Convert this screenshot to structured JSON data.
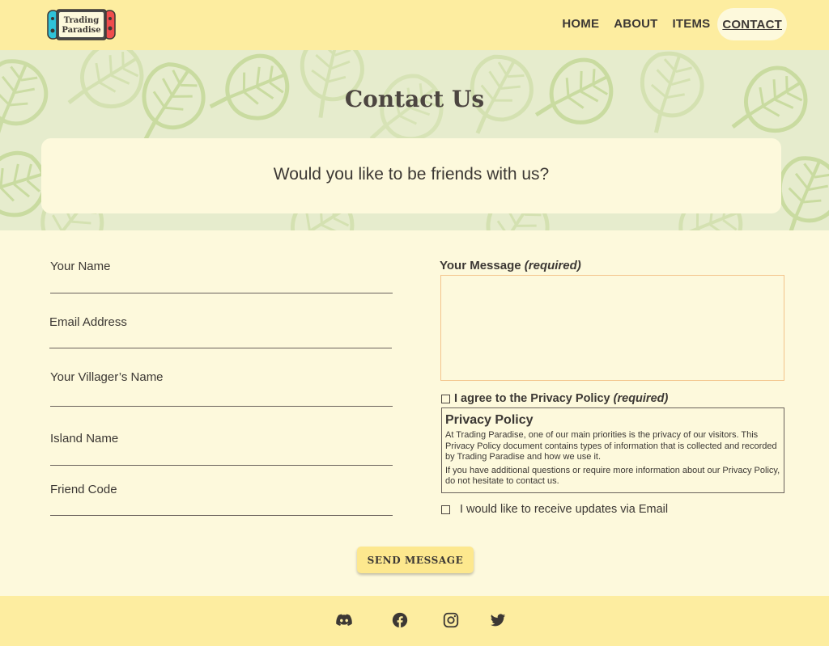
{
  "header": {
    "logo_line1": "Trading",
    "logo_line2": "Paradise",
    "nav": [
      {
        "label": "HOME"
      },
      {
        "label": "ABOUT"
      },
      {
        "label": "ITEMS"
      },
      {
        "label": "CONTACT"
      }
    ]
  },
  "hero": {
    "title": "Contact Us",
    "subtitle": "Would you like to be friends with us?"
  },
  "form": {
    "fields": [
      {
        "label": "Your Name",
        "value": ""
      },
      {
        "label": "Email Address",
        "value": ""
      },
      {
        "label": "Your Villager’s Name",
        "value": ""
      },
      {
        "label": "Island Name",
        "value": ""
      },
      {
        "label": "Friend Code",
        "value": ""
      }
    ],
    "message_label": "Your Message",
    "required_tag": "(required)",
    "message_value": "",
    "agree_label": "I agree to the Privacy Policy",
    "agree_checked": false,
    "policy_title": "Privacy Policy",
    "policy_p1": "At Trading Paradise, one of our main priorities is the privacy of our visitors. This Privacy Policy document contains types of information that is collected and recorded by Trading Paradise and how we use it.",
    "policy_p2": "If you have additional questions or require more information about our Privacy Policy, do not hesitate to contact us.",
    "updates_label": "I would like to receive updates via Email",
    "updates_checked": false,
    "submit_label": "SEND MESSAGE"
  },
  "footer": {
    "social": [
      "discord-icon",
      "facebook-icon",
      "instagram-icon",
      "twitter-icon"
    ]
  },
  "colors": {
    "header_bg": "#fdeda0",
    "page_bg": "#fdf9dc",
    "hero_bg": "#e6eccd",
    "leaf": "#cfe0a8",
    "text": "#3c3834",
    "button_bg": "#fde88e",
    "switch_blue": "#2fc2d8",
    "switch_red": "#ef4d4d"
  }
}
